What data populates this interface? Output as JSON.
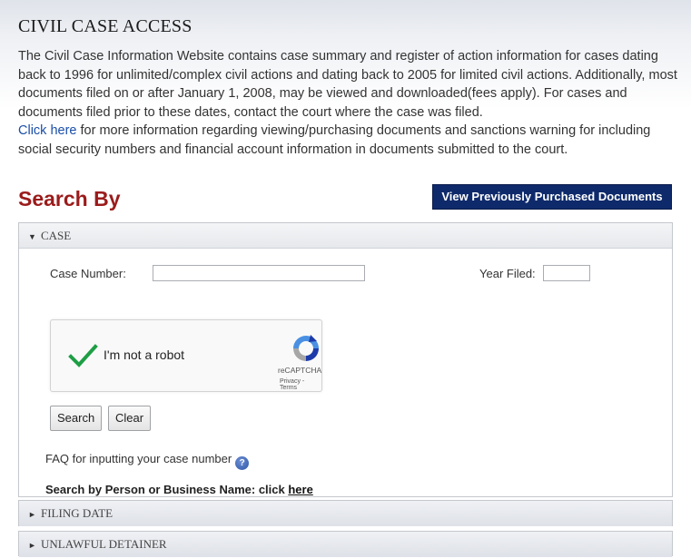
{
  "header": {
    "title": "CIVIL CASE ACCESS",
    "intro_line1": "The Civil Case Information Website contains case summary and register of action information for cases dating back to 1996 for unlimited/complex civil actions and dating back to 2005 for limited civil actions. Additionally, most documents filed on or after January 1, 2008, may be viewed and downloaded(fees apply). For cases and documents filed prior to these dates, contact the court where the case was filed.",
    "click_here": "Click here",
    "intro_line2": " for more information regarding viewing/purchasing documents and sanctions warning for including social security numbers and financial account information in documents submitted to the court."
  },
  "search": {
    "heading": "Search By",
    "purchased_button": "View Previously Purchased Documents"
  },
  "panels": {
    "case": {
      "title": "CASE",
      "expanded": true,
      "case_number_label": "Case Number:",
      "case_number_value": "",
      "year_filed_label": "Year Filed:",
      "year_filed_value": "",
      "recaptcha": {
        "label": "I'm not a robot",
        "brand": "reCAPTCHA",
        "terms": "Privacy - Terms",
        "checked": true
      },
      "search_button": "Search",
      "clear_button": "Clear",
      "faq_text": "FAQ for inputting your case number",
      "name_search_text": "Search by Person or Business Name: click ",
      "name_search_link": "here"
    },
    "filing_date": {
      "title": "FILING DATE",
      "expanded": false
    },
    "unlawful_detainer": {
      "title": "UNLAWFUL DETAINER",
      "expanded": false
    }
  },
  "colors": {
    "heading_red": "#9b1b1b",
    "button_navy": "#0f2a6b",
    "link_blue": "#1a4ea8",
    "check_green": "#1e9e45"
  },
  "icons": {
    "expanded_caret": "caret-down-icon",
    "collapsed_caret": "caret-right-icon",
    "help": "question-circle-icon",
    "recaptcha": "recaptcha-logo-icon"
  }
}
